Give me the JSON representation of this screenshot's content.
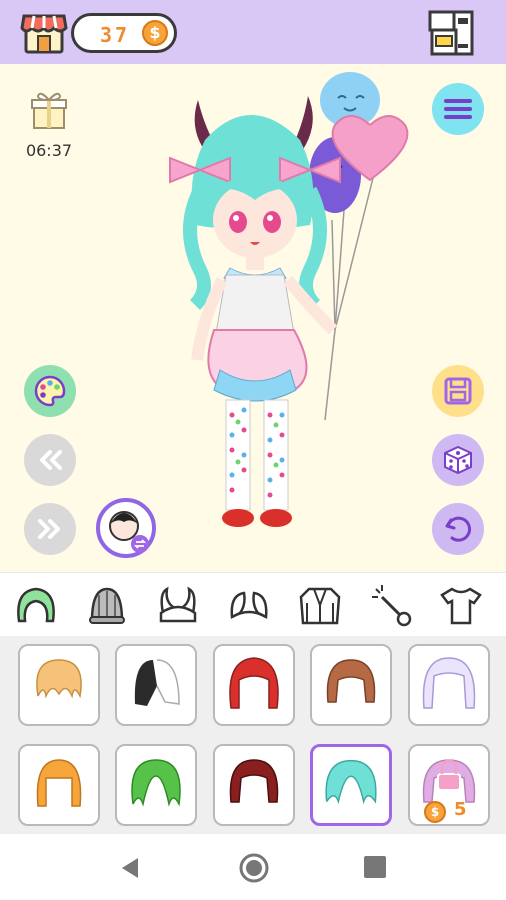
{
  "header": {
    "coins": "37",
    "coin_symbol": "$"
  },
  "stage": {
    "gift_timer": "06:37"
  },
  "categories": [
    {
      "icon": "hair-icon",
      "selected": true
    },
    {
      "icon": "hat-icon"
    },
    {
      "icon": "horns-icon"
    },
    {
      "icon": "bunny-ears-icon"
    },
    {
      "icon": "jacket-icon"
    },
    {
      "icon": "wand-icon"
    },
    {
      "icon": "shirt-icon"
    }
  ],
  "hair_items": [
    {
      "color": "#f6c27a",
      "style": "bob"
    },
    {
      "color": "#2b2b2b",
      "style": "split"
    },
    {
      "color": "#d9302c",
      "style": "long"
    },
    {
      "color": "#b56a45",
      "style": "bob"
    },
    {
      "color": "#d8ccf6",
      "style": "long"
    },
    {
      "color": "#f6a53a",
      "style": "straight"
    },
    {
      "color": "#57c24a",
      "style": "wavy"
    },
    {
      "color": "#8a1f1f",
      "style": "bob"
    },
    {
      "color": "#6fe0d6",
      "style": "wavy",
      "selected": true
    },
    {
      "color": "#d58ad8",
      "style": "locked",
      "locked": true,
      "price": "5",
      "price_symbol": "$"
    }
  ],
  "colors": {
    "topbar": "#d9c8f6",
    "accent": "#a066e8",
    "stage_bg": "#fffbe6",
    "coin": "#f08a2c"
  }
}
